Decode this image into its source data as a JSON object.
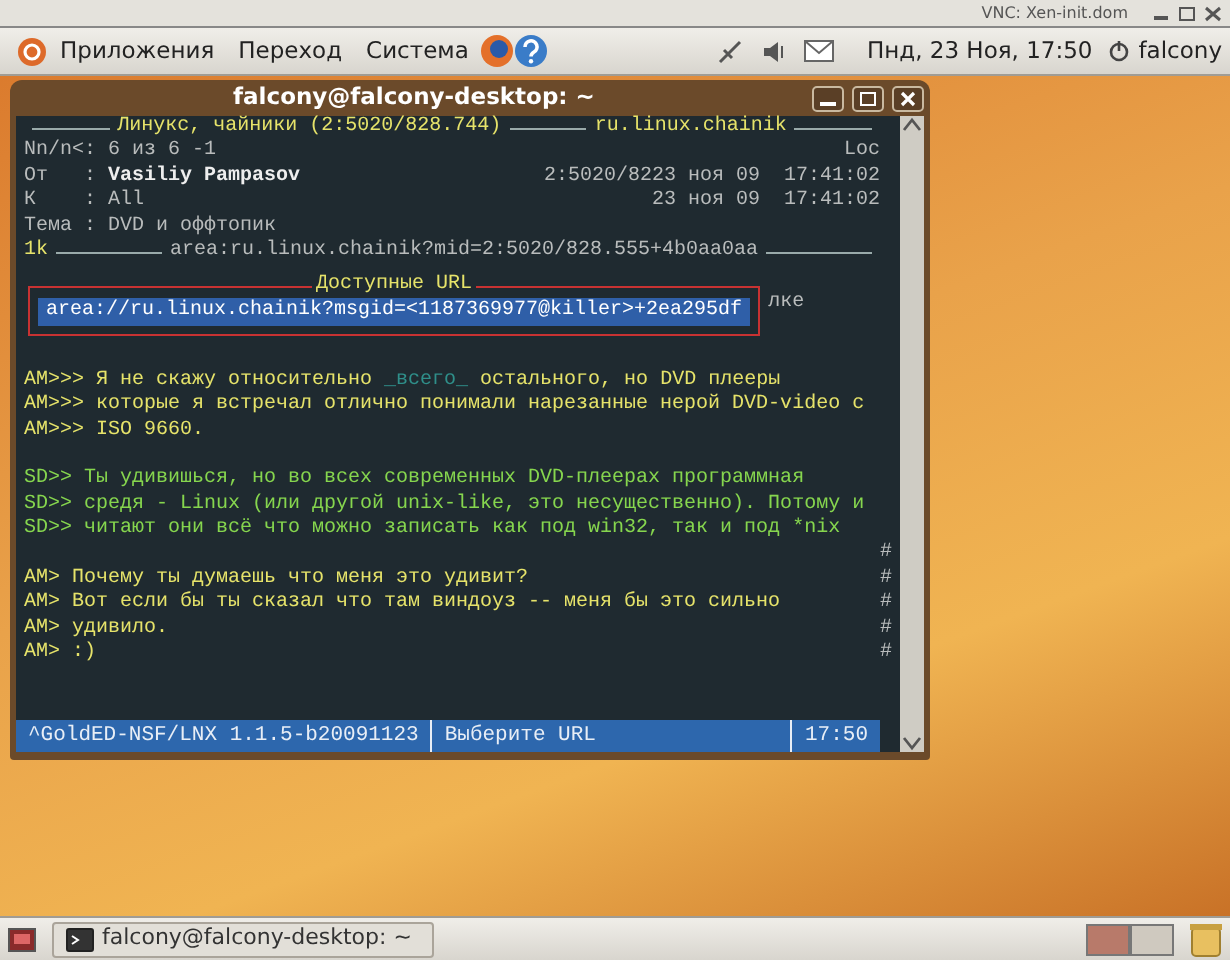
{
  "vnc_bar": {
    "title": "VNC: Xen-init.dom"
  },
  "top_panel": {
    "menus": [
      "Приложения",
      "Переход",
      "Система"
    ],
    "clock": "Пнд, 23 Ноя, 17:50",
    "user": "falcony"
  },
  "terminal": {
    "title": "falcony@falcony-desktop: ~",
    "header": {
      "area_title": "Линукс, чайники (2:5020/828.744)",
      "echo": "ru.linux.chainik"
    },
    "fields": [
      {
        "label": "Nn/n<:",
        "value": "6 из 6 -1",
        "right": "Loc",
        "emphasis": false
      },
      {
        "label": "От   :",
        "value": "Vasiliy Pampasov",
        "right": "2:5020/8223 ноя 09  17:41:02",
        "emphasis": true
      },
      {
        "label": "К    :",
        "value": "All",
        "right": "23 ноя 09  17:41:02",
        "emphasis": false
      },
      {
        "label": "Тема :",
        "value": "DVD и оффтопик",
        "emphasis": false
      }
    ],
    "link_line": {
      "mark": "1k",
      "text": "area:ru.linux.chainik?mid=2:5020/828.555+4b0aa0aa"
    },
    "url_popup": {
      "title": "Доступные URL",
      "items": [
        {
          "text": "area://ru.linux.chainik?msgid=<1187369977@killer>+2ea295df",
          "selected": true
        }
      ],
      "behind_text": "лке"
    },
    "lines": [
      {
        "kind": "blank"
      },
      {
        "kind": "quote_am",
        "parts": [
          {
            "kind": "text",
            "text": "AM>>> Я не скажу относительно "
          },
          {
            "kind": "hidden",
            "text": "_всего_"
          },
          {
            "kind": "text",
            "text": " остального, но DVD плееры"
          }
        ]
      },
      {
        "kind": "quote_am",
        "parts": [
          {
            "kind": "text",
            "text": "AM>>> которые я встречал отлично понимали нарезанные нерой DVD-video c"
          }
        ]
      },
      {
        "kind": "quote_am",
        "parts": [
          {
            "kind": "text",
            "text": "AM>>> ISO 9660."
          }
        ]
      },
      {
        "kind": "blank"
      },
      {
        "kind": "quote_sd",
        "parts": [
          {
            "kind": "text",
            "text": "SD>> Ты удивишься, но во всех современных DVD-плеерах программная"
          }
        ]
      },
      {
        "kind": "quote_sd",
        "parts": [
          {
            "kind": "text",
            "text": "SD>> средя - Linux (или другой unix-like, это несущественно). Потому и"
          }
        ]
      },
      {
        "kind": "quote_sd",
        "parts": [
          {
            "kind": "text",
            "text": "SD>> читают они всё что можно записать как под win32, так и под *nix"
          }
        ]
      },
      {
        "kind": "blank",
        "mark": "#"
      },
      {
        "kind": "quote_am",
        "mark": "#",
        "parts": [
          {
            "kind": "text",
            "text": "AM> Почему ты думаешь что меня это удивит?"
          }
        ]
      },
      {
        "kind": "quote_am",
        "mark": "#",
        "parts": [
          {
            "kind": "text",
            "text": "AM> Вот если бы ты сказал что там виндоуз -- меня бы это сильно"
          }
        ]
      },
      {
        "kind": "quote_am",
        "mark": "#",
        "parts": [
          {
            "kind": "text",
            "text": "AM> удивило."
          }
        ]
      },
      {
        "kind": "quote_am",
        "mark": "#",
        "parts": [
          {
            "kind": "text",
            "text": "AM> :)"
          }
        ]
      }
    ],
    "status_bar": {
      "program": "^GoldED-NSF/LNX 1.1.5-b20091123",
      "prompt": "Выберите URL",
      "time": "17:50"
    }
  },
  "taskbar": {
    "tasks": [
      {
        "title": "falcony@falcony-desktop: ~",
        "selected": false
      }
    ]
  }
}
